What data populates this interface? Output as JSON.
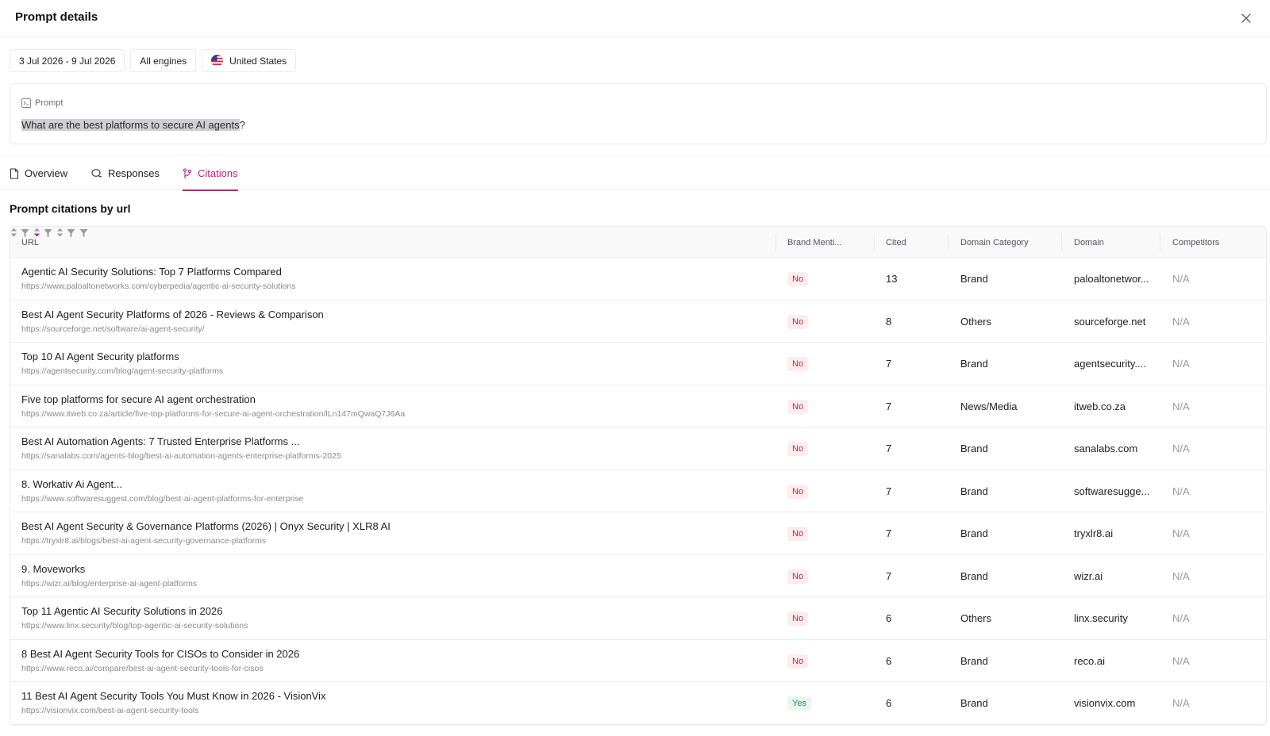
{
  "header": {
    "title": "Prompt details"
  },
  "filters": {
    "date_range": "3 Jul 2026 - 9 Jul 2026",
    "engines": "All engines",
    "country": "United States"
  },
  "prompt": {
    "label": "Prompt",
    "text_highlighted": "What are the best platforms to secure AI agents",
    "text_rest": "?"
  },
  "tabs": [
    {
      "label": "Overview",
      "active": false
    },
    {
      "label": "Responses",
      "active": false
    },
    {
      "label": "Citations",
      "active": true
    }
  ],
  "section": {
    "title": "Prompt citations by url"
  },
  "table": {
    "columns": [
      "URL",
      "Brand Menti...",
      "Cited",
      "Domain Category",
      "Domain",
      "Competitors"
    ],
    "rows": [
      {
        "title": "Agentic AI Security Solutions: Top 7 Platforms Compared",
        "url": "https://www.paloaltonetworks.com/cyberpedia/agentic-ai-security-solutions",
        "brand": "No",
        "cited": "13",
        "category": "Brand",
        "domain": "paloaltonetwor...",
        "competitors": "N/A"
      },
      {
        "title": "Best AI Agent Security Platforms of 2026 - Reviews & Comparison",
        "url": "https://sourceforge.net/software/ai-agent-security/",
        "brand": "No",
        "cited": "8",
        "category": "Others",
        "domain": "sourceforge.net",
        "competitors": "N/A"
      },
      {
        "title": "Top 10 AI Agent Security platforms",
        "url": "https://agentsecurity.com/blog/agent-security-platforms",
        "brand": "No",
        "cited": "7",
        "category": "Brand",
        "domain": "agentsecurity....",
        "competitors": "N/A"
      },
      {
        "title": "Five top platforms for secure AI agent orchestration",
        "url": "https://www.itweb.co.za/article/five-top-platforms-for-secure-ai-agent-orchestration/lLn147mQwaQ7J6Aa",
        "brand": "No",
        "cited": "7",
        "category": "News/Media",
        "domain": "itweb.co.za",
        "competitors": "N/A"
      },
      {
        "title": "Best AI Automation Agents: 7 Trusted Enterprise Platforms ...",
        "url": "https://sanalabs.com/agents-blog/best-ai-automation-agents-enterprise-platforms-2025",
        "brand": "No",
        "cited": "7",
        "category": "Brand",
        "domain": "sanalabs.com",
        "competitors": "N/A"
      },
      {
        "title": "8. Workativ Ai Agent...",
        "url": "https://www.softwaresuggest.com/blog/best-ai-agent-platforms-for-enterprise",
        "brand": "No",
        "cited": "7",
        "category": "Brand",
        "domain": "softwaresugge...",
        "competitors": "N/A"
      },
      {
        "title": "Best AI Agent Security & Governance Platforms (2026) | Onyx Security | XLR8 AI",
        "url": "https://tryxlr8.ai/blogs/best-ai-agent-security-governance-platforms",
        "brand": "No",
        "cited": "7",
        "category": "Brand",
        "domain": "tryxlr8.ai",
        "competitors": "N/A"
      },
      {
        "title": "9. Moveworks",
        "url": "https://wizr.ai/blog/enterprise-ai-agent-platforms",
        "brand": "No",
        "cited": "7",
        "category": "Brand",
        "domain": "wizr.ai",
        "competitors": "N/A"
      },
      {
        "title": "Top 11 Agentic AI Security Solutions in 2026",
        "url": "https://www.linx.security/blog/top-agentic-ai-security-solutions",
        "brand": "No",
        "cited": "6",
        "category": "Others",
        "domain": "linx.security",
        "competitors": "N/A"
      },
      {
        "title": "8 Best AI Agent Security Tools for CISOs to Consider in 2026",
        "url": "https://www.reco.ai/compare/best-ai-agent-security-tools-for-cisos",
        "brand": "No",
        "cited": "6",
        "category": "Brand",
        "domain": "reco.ai",
        "competitors": "N/A"
      },
      {
        "title": "11 Best AI Agent Security Tools You Must Know in 2026 - VisionVix",
        "url": "https://visionvix.com/best-ai-agent-security-tools",
        "brand": "Yes",
        "cited": "6",
        "category": "Brand",
        "domain": "visionvix.com",
        "competitors": "N/A"
      }
    ]
  },
  "colors": {
    "accent": "#c0237a",
    "no_badge_bg": "#fdecee",
    "no_badge_text": "#c52834",
    "yes_badge_bg": "#eaf7ee",
    "yes_badge_text": "#2f8d4a"
  },
  "icons": {
    "close": "close-icon",
    "prompt": "terminal-icon",
    "overview": "document-icon",
    "responses": "chat-icon",
    "citations": "branch-icon",
    "sort": "sort-icon",
    "filter": "filter-icon",
    "flag": "us-flag-icon"
  }
}
